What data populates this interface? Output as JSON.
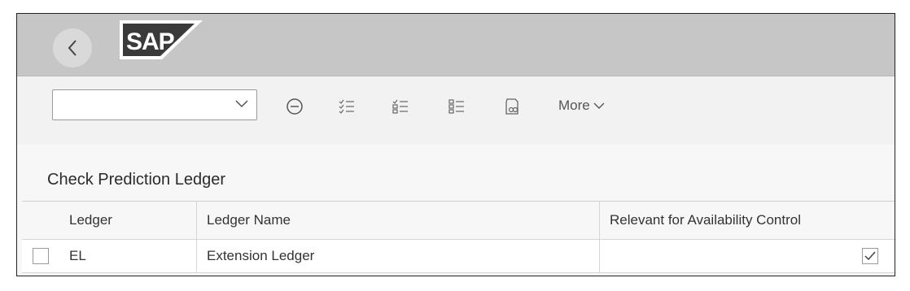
{
  "shell": {
    "logo_text": "SAP",
    "back_icon": "chevron-left-icon"
  },
  "toolbar": {
    "select_value": "",
    "icons": [
      "collapse-icon",
      "checklist-icon",
      "checklist-alt-icon",
      "list-icon",
      "variant-icon"
    ],
    "more_label": "More"
  },
  "section": {
    "title": "Check Prediction Ledger"
  },
  "table": {
    "columns": [
      "Ledger",
      "Ledger Name",
      "Relevant for Availability Control"
    ],
    "rows": [
      {
        "ledger": "EL",
        "name": "Extension Ledger",
        "relevant": true,
        "selected": false
      }
    ]
  },
  "colors": {
    "shellbar": "#c6c6c6",
    "background": "#f7f7f7"
  }
}
